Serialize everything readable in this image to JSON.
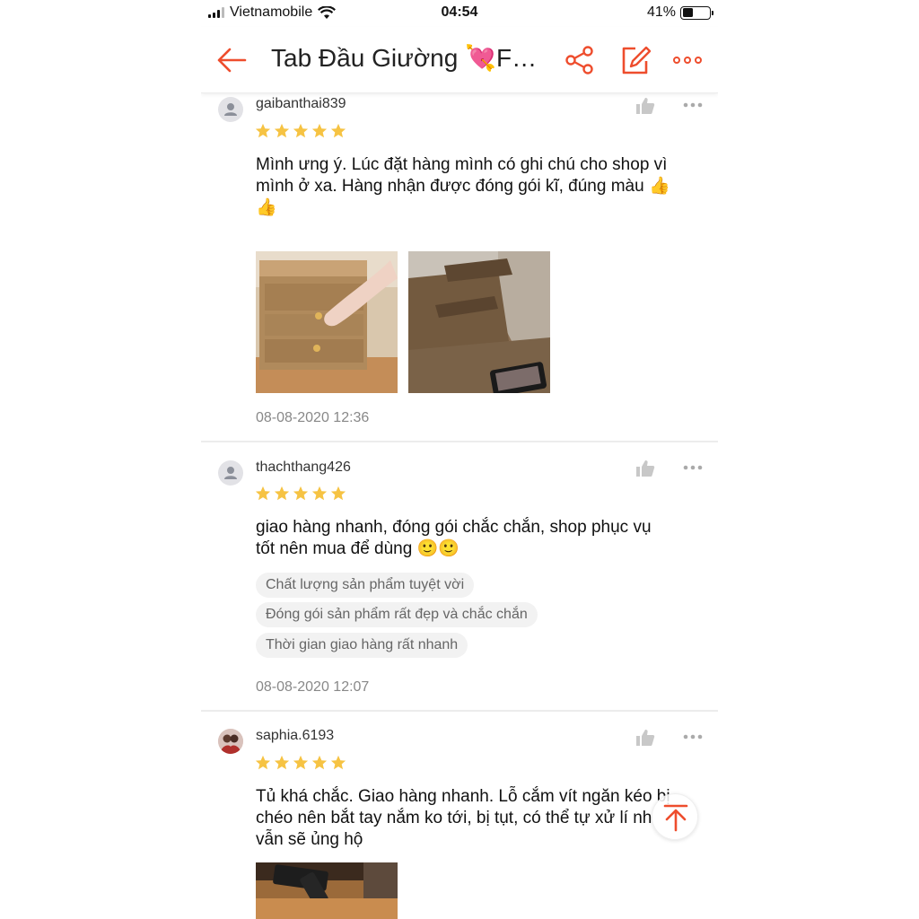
{
  "status_bar": {
    "carrier": "Vietnamobile",
    "time": "04:54",
    "battery": "41%",
    "battery_level": 0.41
  },
  "nav": {
    "title": "Tab Đầu Giường 💘F…",
    "icons": [
      "back-arrow-icon",
      "share-icon",
      "edit-icon",
      "more-icon"
    ],
    "accent_color": "#ee4d2d"
  },
  "reviews": [
    {
      "username": "gaibanthai839",
      "rating": 5,
      "text_line1": "Mình ưng ý. Lúc đặt hàng mình có ghi chú cho shop vì",
      "text_line2": "mình ở xa. Hàng nhận được đóng gói kĩ, đúng màu 👍",
      "text_line3": "👍",
      "date": "08-08-2020 12:36"
    },
    {
      "username": "thachthang426",
      "rating": 5,
      "text_line1": "giao hàng nhanh, đóng gói chắc chắn, shop phục vụ",
      "text_line2": "tốt nên mua để dùng 🙂🙂",
      "tags": [
        "Chất lượng sản phẩm tuyệt vời",
        "Đóng gói sản phẩm rất đẹp và chắc chắn",
        "Thời gian giao hàng rất nhanh"
      ],
      "date": "08-08-2020 12:07"
    },
    {
      "username": "saphia.6193",
      "rating": 5,
      "text_line1": "Tủ khá chắc. Giao hàng nhanh. Lỗ cắm vít ngăn kéo bị",
      "text_line2": "chéo nên bắt tay nắm ko tới, bị tụt, có thể tự xử lí nh",
      "text_line3": "vẫn sẽ ủng hộ"
    }
  ],
  "colors": {
    "star": "#f6c343",
    "icon_grey": "#c8c8c8",
    "date_grey": "#888888"
  }
}
